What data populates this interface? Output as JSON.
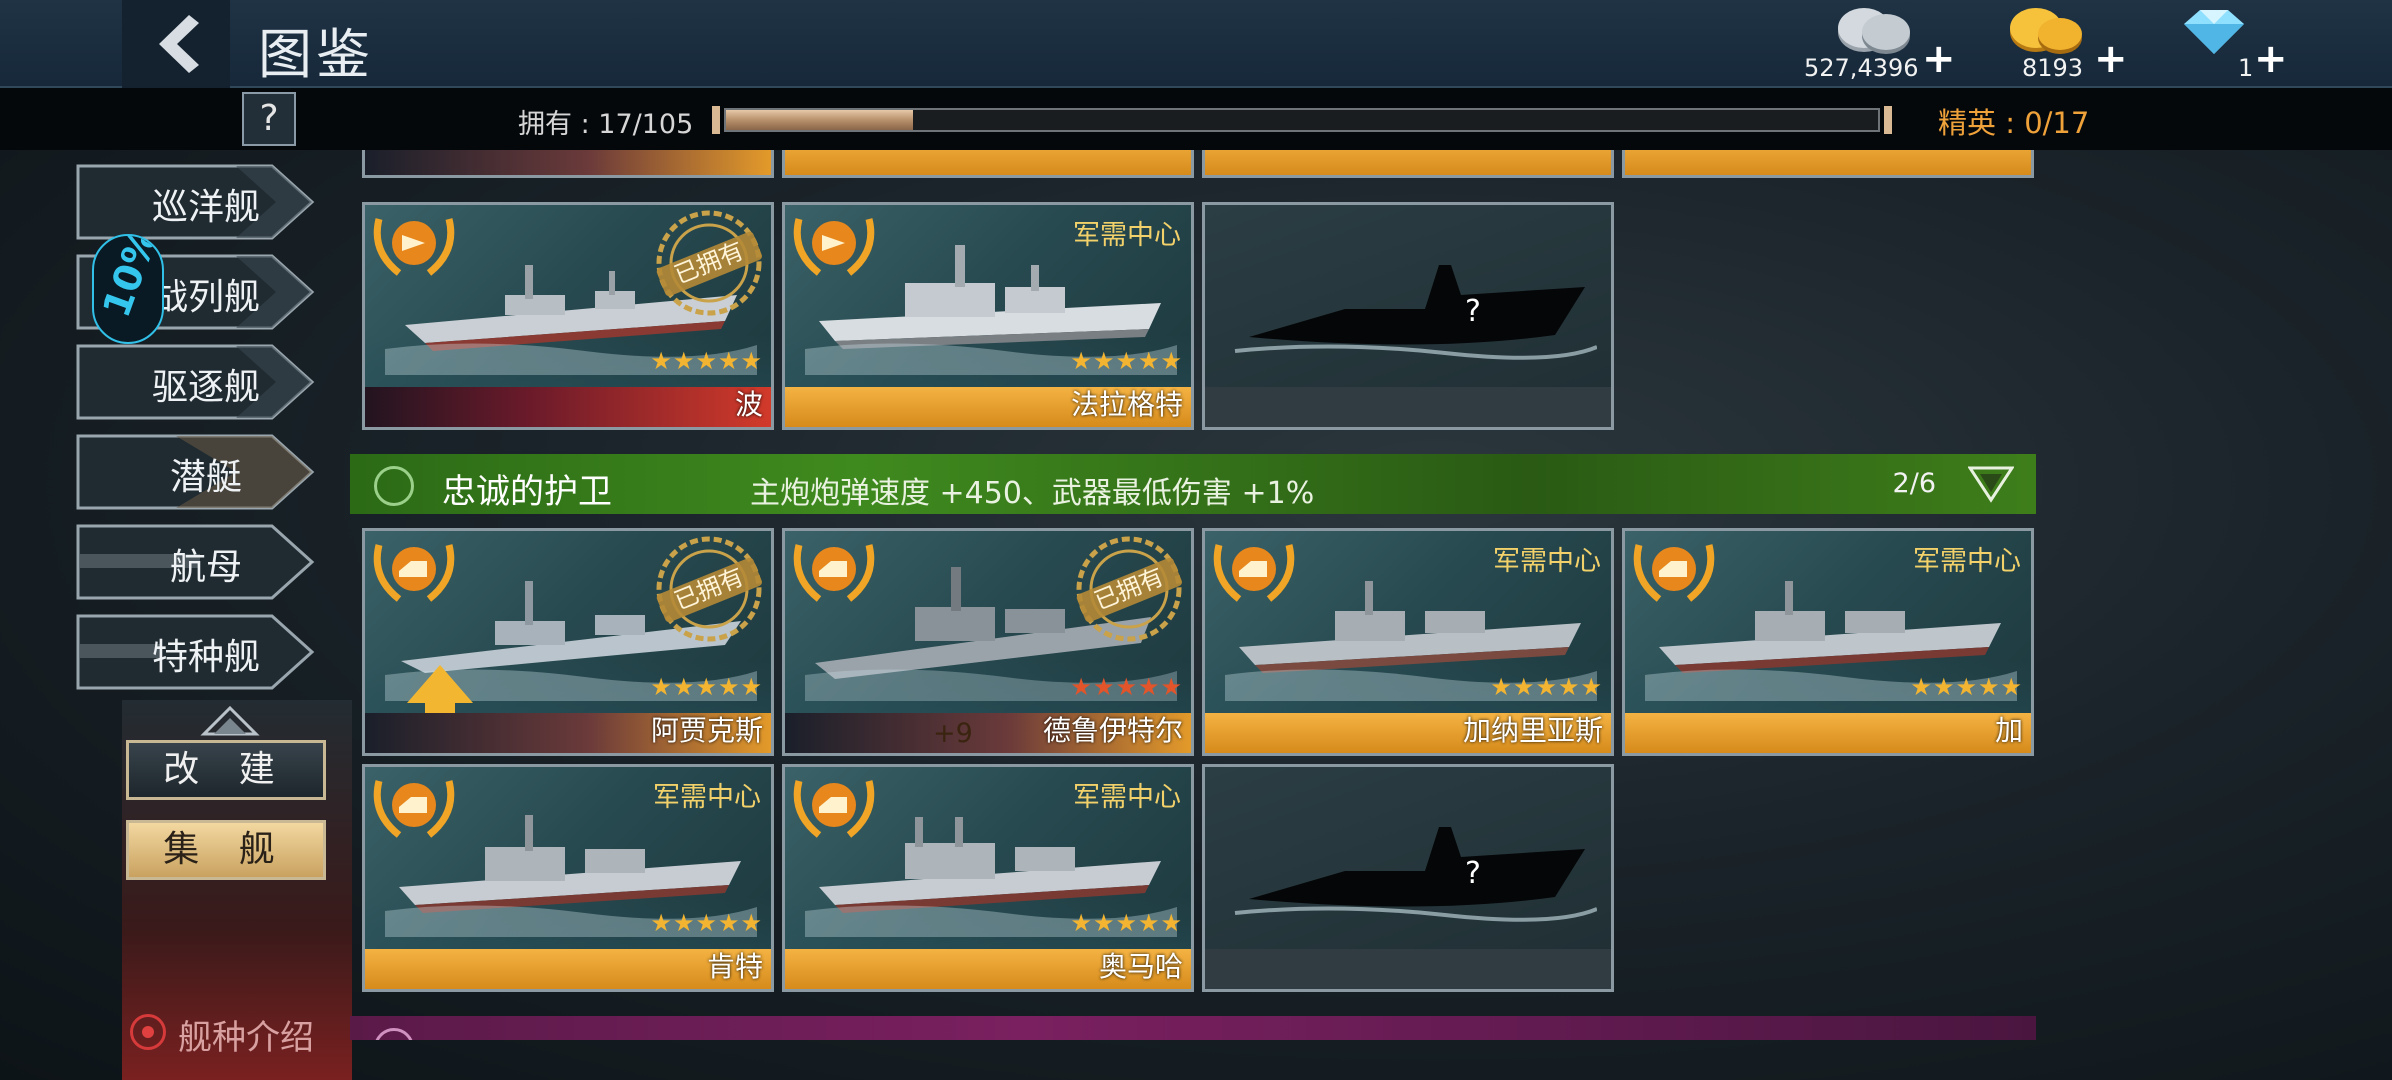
{
  "header": {
    "title": "图鉴"
  },
  "currencies": [
    {
      "name": "silver-coins",
      "value": "527,4396",
      "color": "#c8cfd6"
    },
    {
      "name": "gold-coins",
      "value": "8193",
      "color": "#f2b431"
    },
    {
      "name": "diamonds",
      "value": "1",
      "color": "#7fd6ff"
    }
  ],
  "collection": {
    "owned_label": "拥有 : 17/105",
    "owned": 17,
    "total": 105,
    "elite_label": "精英 : 0/17",
    "help": "?"
  },
  "sidebar": {
    "tabs": [
      {
        "label": "巡洋舰"
      },
      {
        "label": "战列舰"
      },
      {
        "label": "驱逐舰"
      },
      {
        "label": "潜艇"
      },
      {
        "label": "航母"
      },
      {
        "label": "特种舰"
      }
    ],
    "upgrade_label": "改 建",
    "collect_label": "集 舰",
    "class_intro_label": "舰种介绍"
  },
  "grid": {
    "owned_stamp": "已拥有",
    "source_label": "军需中心",
    "stars": "★★★★★",
    "row_a": [
      {
        "name": "波",
        "owned": true,
        "source": "",
        "bar": "red"
      },
      {
        "name": "法拉格特",
        "owned": false,
        "source": "军需中心",
        "bar": "gold"
      },
      {
        "name": "",
        "silhouette": true
      }
    ],
    "set_loyal": {
      "name": "忠诚的护卫",
      "bonus": "主炮炮弹速度 +450、武器最低伤害 +1%",
      "count": "2/6",
      "color": "#3f8a1e"
    },
    "row_b": [
      {
        "name": "阿贾克斯",
        "owned": true,
        "bar": "dark"
      },
      {
        "name": "德鲁伊特尔",
        "owned": true,
        "bar": "dark",
        "level": "+9"
      },
      {
        "name": "加纳里亚斯",
        "owned": false,
        "source": "军需中心",
        "bar": "gold"
      },
      {
        "name": "加",
        "owned": false,
        "source": "军需中心",
        "bar": "gold"
      }
    ],
    "row_c": [
      {
        "name": "肯特",
        "owned": false,
        "source": "军需中心",
        "bar": "gold"
      },
      {
        "name": "奥马哈",
        "owned": false,
        "source": "军需中心",
        "bar": "gold"
      },
      {
        "name": "",
        "silhouette": true
      }
    ],
    "next_set": {
      "color": "#7a2060"
    }
  }
}
